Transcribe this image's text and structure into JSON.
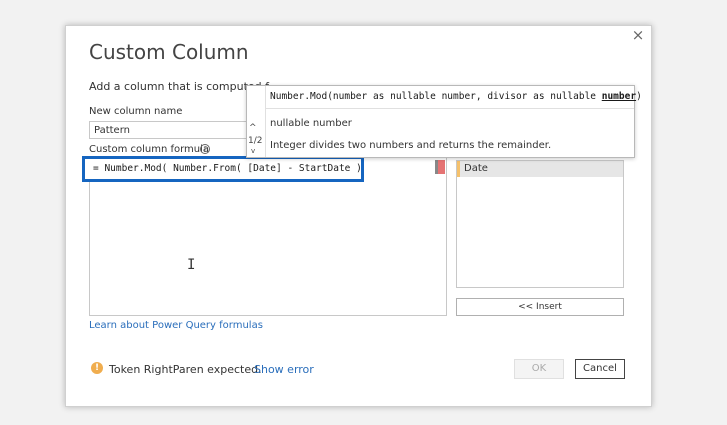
{
  "dialog": {
    "title": "Custom Column",
    "subtitle": "Add a column that is computed f",
    "close_icon": "×"
  },
  "new_column": {
    "label": "New column name",
    "value": "Pattern"
  },
  "formula": {
    "label": "Custom column formula",
    "info_icon": "i",
    "text": "= Number.Mod( Number.From( [Date] - StartDate )",
    "cursor_icon": "I"
  },
  "available_columns": {
    "items": [
      "Date"
    ]
  },
  "insert_button": "<< Insert",
  "learn_link": "Learn about Power Query formulas",
  "status": {
    "warning_icon": "!",
    "message": "Token RightParen expected.",
    "show_error": "Show error"
  },
  "buttons": {
    "ok": "OK",
    "cancel": "Cancel"
  },
  "tooltip": {
    "signature": "Number.Mod(number as nullable number, divisor as nullable ",
    "signature_bold": "number",
    "signature_end": ")",
    "nav_up": "^",
    "nav_count": "1/2",
    "nav_down": "v",
    "return_type": "nullable number",
    "description": "Integer divides two numbers and returns the remainder."
  },
  "colors": {
    "highlight_border": "#1565c0",
    "link": "#2a6ebb",
    "warning": "#f0ad4e"
  }
}
